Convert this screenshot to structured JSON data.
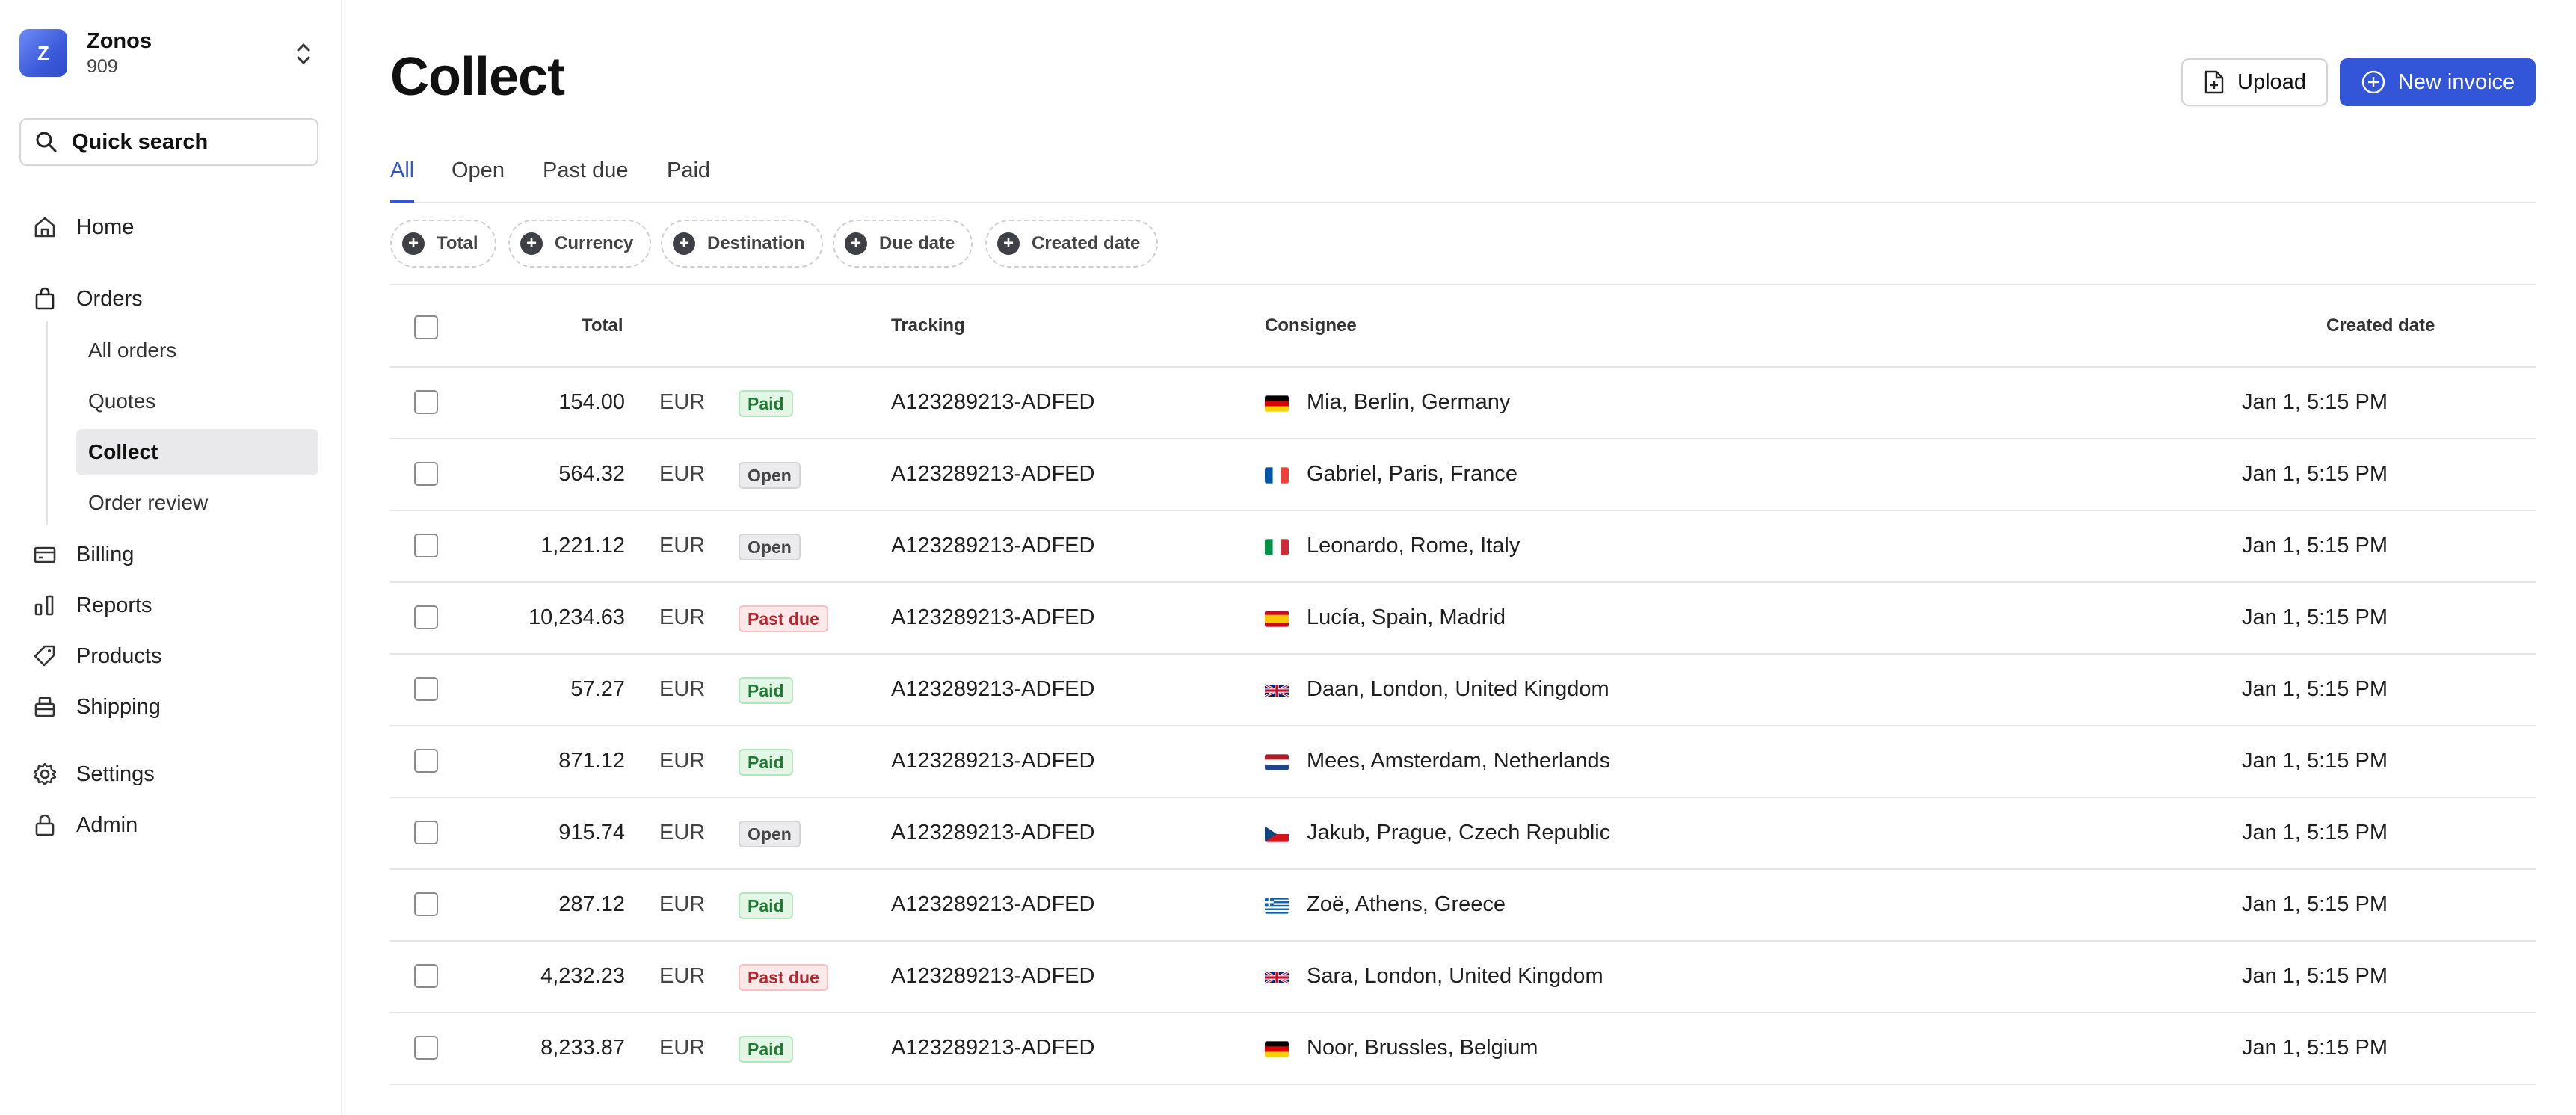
{
  "sidebar": {
    "org": {
      "logo_letter": "Z",
      "name": "Zonos",
      "id": "909"
    },
    "quick_search": "Quick search",
    "nav": [
      {
        "label": "Home",
        "icon": "home-icon"
      },
      {
        "label": "Orders",
        "icon": "shopping-bag-icon"
      },
      {
        "label": "Billing",
        "icon": "credit-card-icon"
      },
      {
        "label": "Reports",
        "icon": "bar-chart-icon"
      },
      {
        "label": "Products",
        "icon": "tag-icon"
      },
      {
        "label": "Shipping",
        "icon": "package-icon"
      },
      {
        "label": "Settings",
        "icon": "gear-icon"
      },
      {
        "label": "Admin",
        "icon": "lock-icon"
      }
    ],
    "orders_sub": [
      "All orders",
      "Quotes",
      "Collect",
      "Order review"
    ],
    "active_sub": "Collect"
  },
  "header": {
    "title": "Collect",
    "upload_label": "Upload",
    "new_invoice_label": "New invoice"
  },
  "tabs": [
    "All",
    "Open",
    "Past due",
    "Paid"
  ],
  "active_tab": "All",
  "filters": [
    "Total",
    "Currency",
    "Destination",
    "Due date",
    "Created date"
  ],
  "table": {
    "columns": {
      "total": "Total",
      "tracking": "Tracking",
      "consignee": "Consignee",
      "created": "Created date"
    },
    "rows": [
      {
        "total": "154.00",
        "currency": "EUR",
        "status": "Paid",
        "tracking": "A123289213-ADFED",
        "flag": "de",
        "consignee": "Mia, Berlin, Germany",
        "created": "Jan 1, 5:15 PM"
      },
      {
        "total": "564.32",
        "currency": "EUR",
        "status": "Open",
        "tracking": "A123289213-ADFED",
        "flag": "fr",
        "consignee": "Gabriel, Paris, France",
        "created": "Jan 1, 5:15 PM"
      },
      {
        "total": "1,221.12",
        "currency": "EUR",
        "status": "Open",
        "tracking": "A123289213-ADFED",
        "flag": "it",
        "consignee": "Leonardo, Rome, Italy",
        "created": "Jan 1, 5:15 PM"
      },
      {
        "total": "10,234.63",
        "currency": "EUR",
        "status": "Past due",
        "tracking": "A123289213-ADFED",
        "flag": "es",
        "consignee": "Lucía, Spain, Madrid",
        "created": "Jan 1, 5:15 PM"
      },
      {
        "total": "57.27",
        "currency": "EUR",
        "status": "Paid",
        "tracking": "A123289213-ADFED",
        "flag": "gb",
        "consignee": "Daan, London, United Kingdom",
        "created": "Jan 1, 5:15 PM"
      },
      {
        "total": "871.12",
        "currency": "EUR",
        "status": "Paid",
        "tracking": "A123289213-ADFED",
        "flag": "nl",
        "consignee": "Mees, Amsterdam, Netherlands",
        "created": "Jan 1, 5:15 PM"
      },
      {
        "total": "915.74",
        "currency": "EUR",
        "status": "Open",
        "tracking": "A123289213-ADFED",
        "flag": "cz",
        "consignee": "Jakub, Prague, Czech Republic",
        "created": "Jan 1, 5:15 PM"
      },
      {
        "total": "287.12",
        "currency": "EUR",
        "status": "Paid",
        "tracking": "A123289213-ADFED",
        "flag": "gr",
        "consignee": "Zoë, Athens, Greece",
        "created": "Jan 1, 5:15 PM"
      },
      {
        "total": "4,232.23",
        "currency": "EUR",
        "status": "Past due",
        "tracking": "A123289213-ADFED",
        "flag": "gb",
        "consignee": "Sara,  London, United Kingdom",
        "created": "Jan 1, 5:15 PM"
      },
      {
        "total": "8,233.87",
        "currency": "EUR",
        "status": "Paid",
        "tracking": "A123289213-ADFED",
        "flag": "de",
        "consignee": "Noor, Brussles, Belgium",
        "created": "Jan 1, 5:15 PM"
      }
    ]
  },
  "colors": {
    "accent": "#3355d8",
    "paid": "#1f7a33",
    "past_due": "#b3262d"
  }
}
